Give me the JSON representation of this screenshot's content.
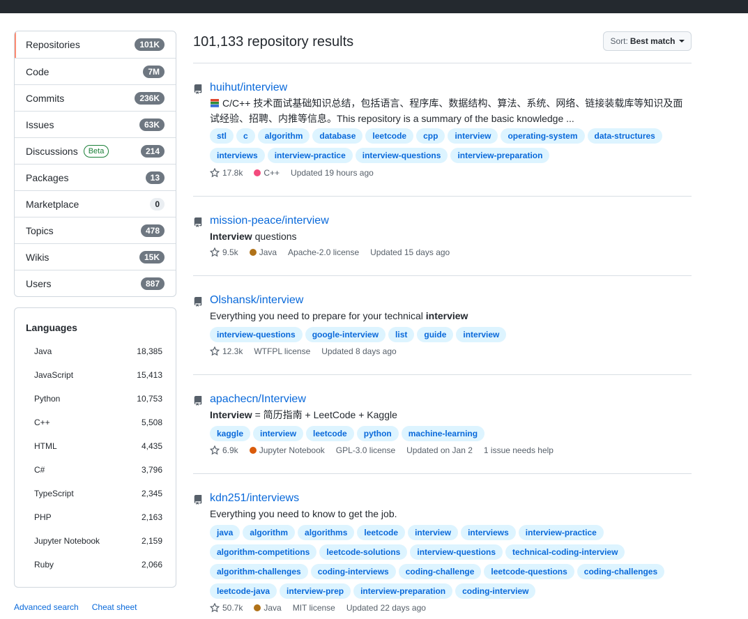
{
  "filters": [
    {
      "label": "Repositories",
      "count": "101K",
      "selected": true
    },
    {
      "label": "Code",
      "count": "7M"
    },
    {
      "label": "Commits",
      "count": "236K"
    },
    {
      "label": "Issues",
      "count": "63K"
    },
    {
      "label": "Discussions",
      "count": "214",
      "badge": "Beta"
    },
    {
      "label": "Packages",
      "count": "13"
    },
    {
      "label": "Marketplace",
      "count": "0"
    },
    {
      "label": "Topics",
      "count": "478"
    },
    {
      "label": "Wikis",
      "count": "15K"
    },
    {
      "label": "Users",
      "count": "887"
    }
  ],
  "languages": {
    "title": "Languages",
    "items": [
      {
        "name": "Java",
        "count": "18,385"
      },
      {
        "name": "JavaScript",
        "count": "15,413"
      },
      {
        "name": "Python",
        "count": "10,753"
      },
      {
        "name": "C++",
        "count": "5,508"
      },
      {
        "name": "HTML",
        "count": "4,435"
      },
      {
        "name": "C#",
        "count": "3,796"
      },
      {
        "name": "TypeScript",
        "count": "2,345"
      },
      {
        "name": "PHP",
        "count": "2,163"
      },
      {
        "name": "Jupyter Notebook",
        "count": "2,159"
      },
      {
        "name": "Ruby",
        "count": "2,066"
      }
    ]
  },
  "footer": {
    "advanced": "Advanced search",
    "cheat": "Cheat sheet"
  },
  "results": {
    "title": "101,133 repository results"
  },
  "sort": {
    "prefix": "Sort:",
    "value": "Best match"
  },
  "repos": [
    {
      "owner": "huihut/",
      "name": "interview",
      "desc": "C/C++ 技术面试基础知识总结，包括语言、程序库、数据结构、算法、系统、网络、链接装载库等知识及面试经验、招聘、内推等信息。This repository is a summary of the basic knowledge ...",
      "topics": [
        "stl",
        "c",
        "algorithm",
        "database",
        "leetcode",
        "cpp",
        "interview",
        "operating-system",
        "data-structures",
        "interviews",
        "interview-practice",
        "interview-questions",
        "interview-preparation"
      ],
      "stars": "17.8k",
      "language": "C++",
      "lang_color": "#f34b7d",
      "license": "",
      "updated": "Updated 19 hours ago",
      "extra": ""
    },
    {
      "owner": "mission-peace/",
      "name": "interview",
      "desc_bold": "Interview",
      "desc": " questions",
      "topics": [],
      "stars": "9.5k",
      "language": "Java",
      "lang_color": "#b07219",
      "license": "Apache-2.0 license",
      "updated": "Updated 15 days ago",
      "extra": ""
    },
    {
      "owner": "Olshansk/",
      "name": "interview",
      "desc": "Everything you need to prepare for your technical ",
      "desc_bold_end": "interview",
      "topics": [
        "interview-questions",
        "google-interview",
        "list",
        "guide",
        "interview"
      ],
      "stars": "12.3k",
      "language": "",
      "lang_color": "",
      "license": "WTFPL license",
      "updated": "Updated 8 days ago",
      "extra": ""
    },
    {
      "owner": "apachecn/",
      "name": "Interview",
      "desc_bold": "Interview",
      "desc": " = 简历指南 + LeetCode + Kaggle",
      "topics": [
        "kaggle",
        "interview",
        "leetcode",
        "python",
        "machine-learning"
      ],
      "stars": "6.9k",
      "language": "Jupyter Notebook",
      "lang_color": "#da5b0b",
      "license": "GPL-3.0 license",
      "updated": "Updated on Jan 2",
      "extra": "1 issue needs help"
    },
    {
      "owner": "kdn251/",
      "name": "interviews",
      "desc": "Everything you need to know to get the job.",
      "topics": [
        "java",
        "algorithm",
        "algorithms",
        "leetcode",
        "interview",
        "interviews",
        "interview-practice",
        "algorithm-competitions",
        "leetcode-solutions",
        "interview-questions",
        "technical-coding-interview",
        "algorithm-challenges",
        "coding-interviews",
        "coding-challenge",
        "leetcode-questions",
        "coding-challenges",
        "leetcode-java",
        "interview-prep",
        "interview-preparation",
        "coding-interview"
      ],
      "stars": "50.7k",
      "language": "Java",
      "lang_color": "#b07219",
      "license": "MIT license",
      "updated": "Updated 22 days ago",
      "extra": ""
    }
  ]
}
